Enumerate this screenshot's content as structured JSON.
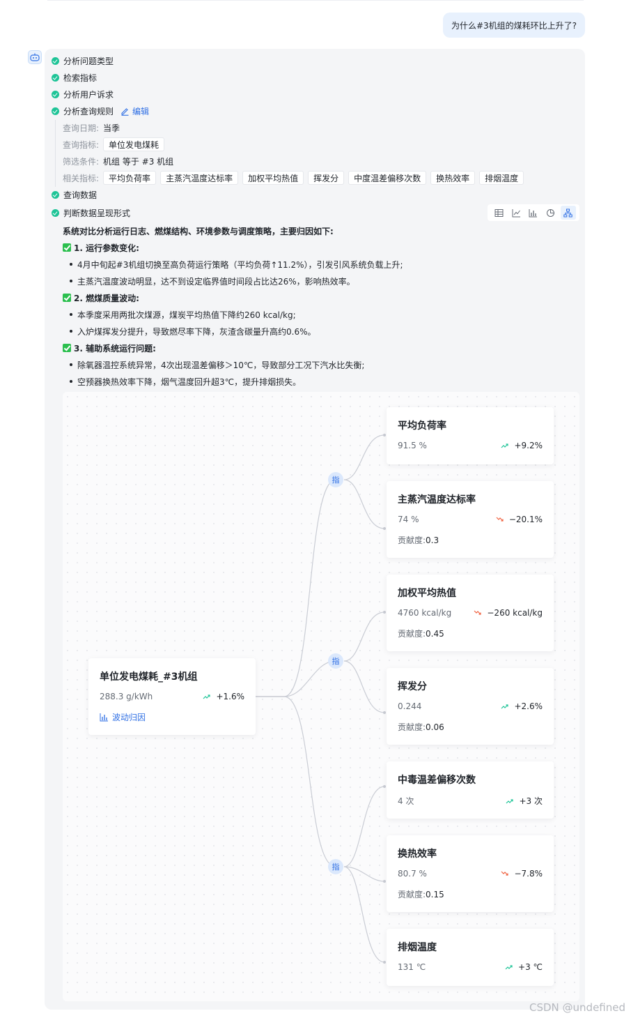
{
  "question": "为什么#3机组的煤耗环比上升了?",
  "steps": {
    "s1": "分析问题类型",
    "s2": "检索指标",
    "s3": "分析用户诉求",
    "s4": "分析查询规则",
    "edit": "编辑",
    "s5": "查询数据",
    "s6": "判断数据呈现形式"
  },
  "rules": {
    "date_label": "查询日期:",
    "date_value": "当季",
    "metric_label": "查询指标:",
    "metric_value": "单位发电煤耗",
    "filter_label": "筛选条件:",
    "filter_value": "机组 等于 #3 机组",
    "related_label": "相关指标:",
    "related": [
      "平均负荷率",
      "主蒸汽温度达标率",
      "加权平均热值",
      "挥发分",
      "中度温差偏移次数",
      "换热效率",
      "排烟温度"
    ]
  },
  "analysis": {
    "intro": "系统对比分析运行日志、燃煤结构、环境参数与调度策略，主要归因如下:",
    "h1": "1. 运行参数变化:",
    "b1": "4月中旬起#3机组切换至高负荷运行策略（平均负荷↑11.2%），引发引风系统负载上升;",
    "b2": "主蒸汽温度波动明显，达不到设定临界值时间段占比达26%，影响热效率。",
    "h2": "2. 燃煤质量波动:",
    "b3": "本季度采用两批次煤源，煤炭平均热值下降约260 kcal/kg;",
    "b4": "入炉煤挥发分提升，导致燃尽率下降，灰渣含碳量升高约0.6%。",
    "h3": "3. 辅助系统运行问题:",
    "b5": "除氧器温控系统异常，4次出现温差偏移＞10℃，导致部分工况下汽水比失衡;",
    "b6": "空预器换热效率下降，烟气温度回升超3℃，提升排烟损失。"
  },
  "tree": {
    "root": {
      "title": "单位发电煤耗_#3机组",
      "value": "288.3 g/kWh",
      "change": "+1.6%",
      "link": "波动归因"
    },
    "group_label": "指",
    "contrib_label": "贡献度:",
    "cards": [
      {
        "title": "平均负荷率",
        "value": "91.5 %",
        "change": "+9.2%",
        "trend": "up",
        "contrib": ""
      },
      {
        "title": "主蒸汽温度达标率",
        "value": "74 %",
        "change": "−20.1%",
        "trend": "down",
        "contrib": "0.3"
      },
      {
        "title": "加权平均热值",
        "value": "4760 kcal/kg",
        "change": "−260 kcal/kg",
        "trend": "down",
        "contrib": "0.45"
      },
      {
        "title": "挥发分",
        "value": "0.244",
        "change": "+2.6%",
        "trend": "up",
        "contrib": "0.06"
      },
      {
        "title": "中毒温差偏移次数",
        "value": "4 次",
        "change": "+3 次",
        "trend": "up",
        "contrib": ""
      },
      {
        "title": "换热效率",
        "value": "80.7 %",
        "change": "−7.8%",
        "trend": "down",
        "contrib": "0.15"
      },
      {
        "title": "排烟温度",
        "value": "131 ℃",
        "change": "+3 ℃",
        "trend": "up",
        "contrib": ""
      }
    ]
  },
  "colors": {
    "accent": "#2f6fe4",
    "success": "#1ec497",
    "up": "#1ec497",
    "down": "#f0603e"
  },
  "watermark": "CSDN @undefined"
}
